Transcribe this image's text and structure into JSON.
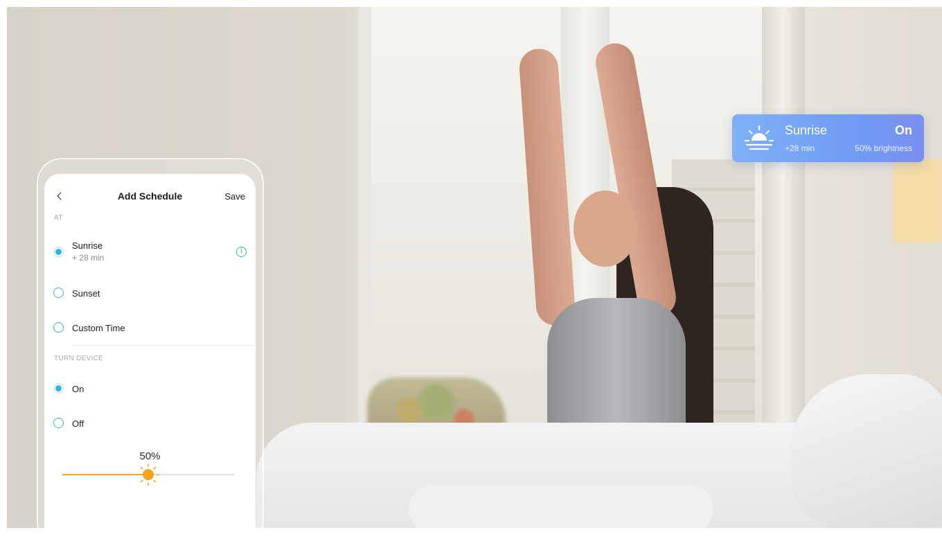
{
  "phone": {
    "nav": {
      "title": "Add Schedule",
      "save_label": "Save"
    },
    "at_section": {
      "label": "AT",
      "options": [
        {
          "label": "Sunrise",
          "sub": "+ 28 min",
          "checked": true
        },
        {
          "label": "Sunset",
          "checked": false
        },
        {
          "label": "Custom Time",
          "checked": false
        }
      ]
    },
    "turn_section": {
      "label": "TURN DEVICE",
      "options": [
        {
          "label": "On",
          "checked": true
        },
        {
          "label": "Off",
          "checked": false
        }
      ]
    },
    "brightness": {
      "label": "50%",
      "value": 0.5
    }
  },
  "notification": {
    "title": "Sunrise",
    "state": "On",
    "offset": "+28 min",
    "brightness": "50% brightness",
    "icon": "sunrise-icon"
  },
  "colors": {
    "accent": "#2fb5e4",
    "slider": "#f5a623",
    "card_start": "#7fb1f7",
    "card_end": "#7b8ff0"
  }
}
